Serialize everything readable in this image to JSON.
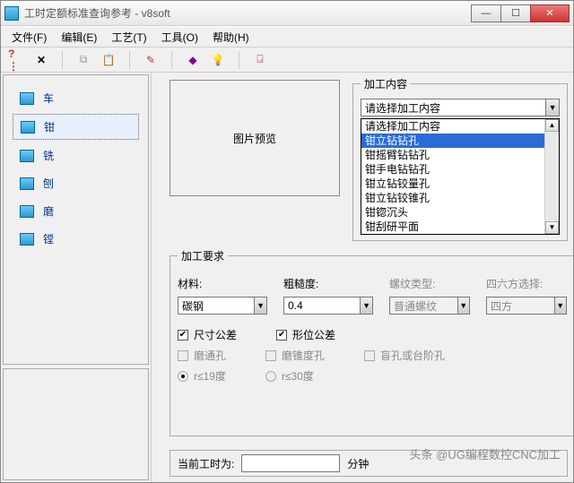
{
  "window": {
    "title": "工时定额标准查询参考 - v8soft"
  },
  "winbtns": {
    "min": "—",
    "max": "☐",
    "close": "✕"
  },
  "menu": {
    "file": "文件(F)",
    "edit": "编辑(E)",
    "tech": "工艺(T)",
    "tool": "工具(O)",
    "help": "帮助(H)"
  },
  "sidebar": {
    "items": [
      {
        "label": "车"
      },
      {
        "label": "钳"
      },
      {
        "label": "铣"
      },
      {
        "label": "刨"
      },
      {
        "label": "磨"
      },
      {
        "label": "镗"
      }
    ],
    "selected_index": 1
  },
  "preview": {
    "label": "图片预览"
  },
  "content_group": {
    "legend": "加工内容",
    "combo_value": "请选择加工内容",
    "options": [
      "请选择加工内容",
      "钳立钻钻孔",
      "钳摇臂钻钻孔",
      "钳手电钻钻孔",
      "钳立钻铰量孔",
      "钳立钻铰锥孔",
      "钳锪沉头",
      "钳刮研平面"
    ],
    "highlight_index": 1
  },
  "req_group": {
    "legend": "加工要求",
    "material_label": "材料:",
    "material_value": "碳钢",
    "rough_label": "粗糙度:",
    "rough_value": "0.4",
    "thread_label": "螺纹类型:",
    "thread_value": "普通螺纹",
    "square_label": "四六方选择:",
    "square_value": "四方",
    "chk_size": "尺寸公差",
    "chk_geom": "形位公差",
    "chk_thru": "磨通孔",
    "chk_cone": "磨锥度孔",
    "chk_blind": "盲孔或台阶孔",
    "rad_19": "r≤19度",
    "rad_30": "r≤30度"
  },
  "footer": {
    "label": "当前工时为:",
    "sep": "分钟"
  },
  "watermark": "头条 @UG编程数控CNC加工"
}
